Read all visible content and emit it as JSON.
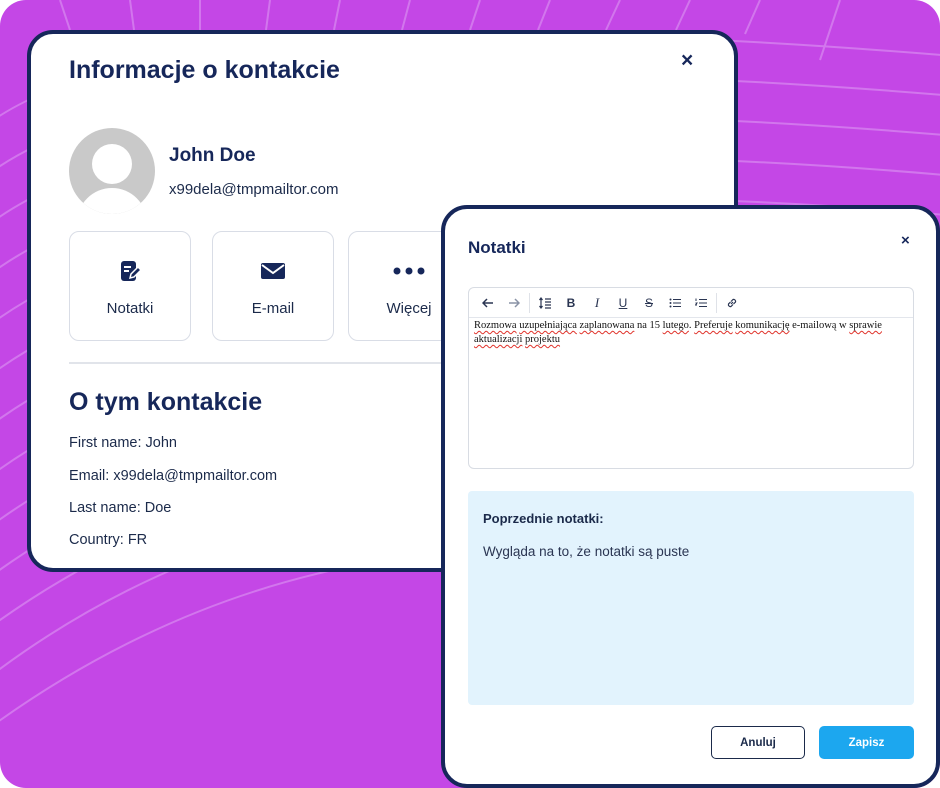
{
  "contact_modal": {
    "title": "Informacje o kontakcie",
    "close_label": "×",
    "name": "John Doe",
    "email": "x99dela@tmpmailtor.com",
    "actions": [
      {
        "label": "Notatki",
        "icon": "notes-edit-icon"
      },
      {
        "label": "E-mail",
        "icon": "envelope-icon"
      },
      {
        "label": "Więcej",
        "icon": "more-dots-icon"
      }
    ],
    "section_title": "O tym kontakcie",
    "details": [
      "First name: John",
      "Email: x99dela@tmpmailtor.com",
      "Last name: Doe",
      "Country: FR"
    ]
  },
  "notes_modal": {
    "title": "Notatki",
    "close_label": "×",
    "toolbar": [
      "undo-icon",
      "redo-icon",
      "line-height-icon",
      "bold-icon",
      "italic-icon",
      "underline-icon",
      "strikethrough-icon",
      "bullet-list-icon",
      "numbered-list-icon",
      "link-icon"
    ],
    "editor_words": [
      "Rozmowa",
      " ",
      "uzupełniająca",
      " ",
      "zaplanowana",
      " na 15 ",
      "lutego",
      ". ",
      "Preferuje",
      " ",
      "komunikację",
      " e-mailową w ",
      "sprawie",
      " ",
      "aktualizacji",
      " ",
      "projektu"
    ],
    "previous_notes_title": "Poprzednie notatki:",
    "previous_notes_empty": "Wygląda na to, że notatki są puste",
    "cancel_label": "Anuluj",
    "save_label": "Zapisz"
  },
  "colors": {
    "background": "#c447e6",
    "card_border": "#16275a",
    "primary_button": "#1ca7ef",
    "notes_panel": "#e2f3fd"
  }
}
